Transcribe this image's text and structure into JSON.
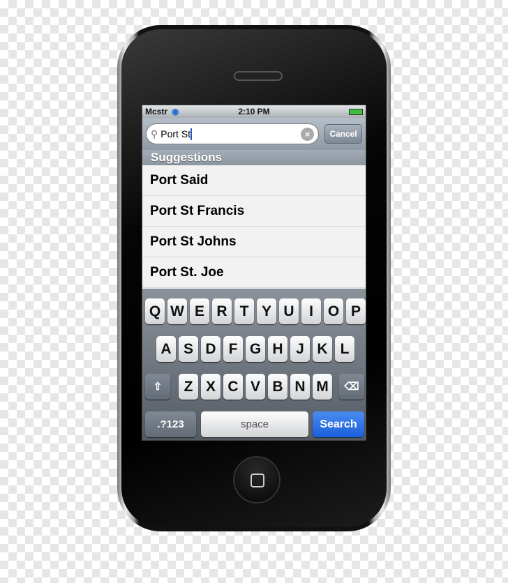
{
  "status": {
    "carrier": "Mcstr",
    "time": "2:10 PM",
    "wifi_icon": "wifi-icon",
    "battery_icon": "battery-charging-icon"
  },
  "search": {
    "value": "Port St",
    "cancel_label": "Cancel"
  },
  "suggestions": {
    "header": "Suggestions",
    "items": [
      "Port Said",
      "Port St Francis",
      "Port St Johns",
      "Port St. Joe"
    ]
  },
  "keyboard": {
    "row1": [
      "Q",
      "W",
      "E",
      "R",
      "T",
      "Y",
      "U",
      "I",
      "O",
      "P"
    ],
    "row2": [
      "A",
      "S",
      "D",
      "F",
      "G",
      "H",
      "J",
      "K",
      "L"
    ],
    "row3": [
      "Z",
      "X",
      "C",
      "V",
      "B",
      "N",
      "M"
    ],
    "numbers_label": ".?123",
    "space_label": "space",
    "search_label": "Search"
  },
  "colors": {
    "search_key": "#1a5fdc"
  }
}
